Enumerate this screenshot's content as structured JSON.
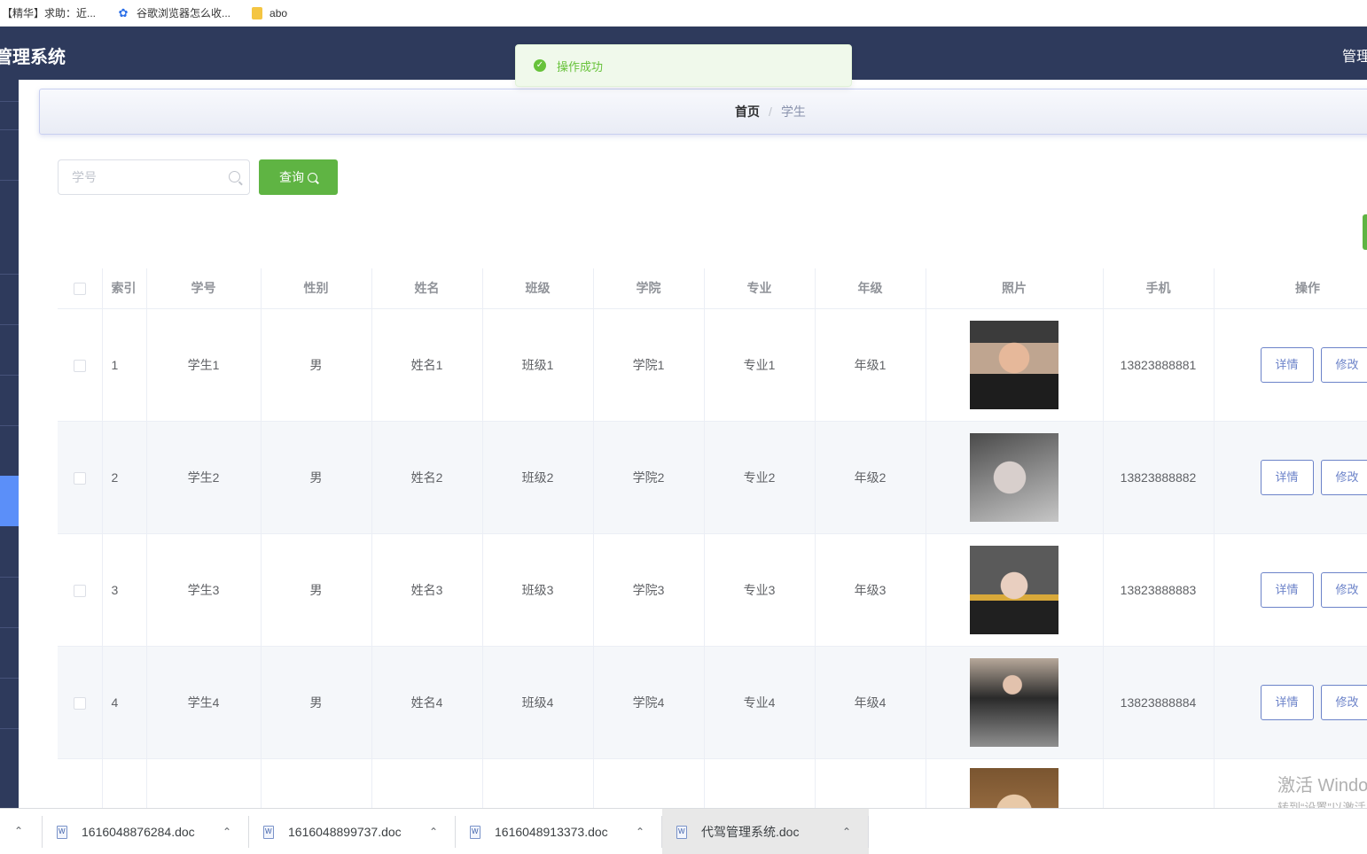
{
  "bookmarks": [
    {
      "label": "【精华】求助：近...",
      "icon": "none"
    },
    {
      "label": "谷歌浏览器怎么收...",
      "icon": "paw-icon"
    },
    {
      "label": "abo",
      "icon": "folder-icon"
    }
  ],
  "header": {
    "title": "管理系统",
    "user": "管理员"
  },
  "breadcrumb": {
    "home": "首页",
    "separator": "/",
    "current": "学生"
  },
  "search": {
    "placeholder": "学号",
    "value": "",
    "button_label": "查询"
  },
  "toast": {
    "message": "操作成功",
    "type": "success"
  },
  "table": {
    "columns": [
      "索引",
      "学号",
      "性别",
      "姓名",
      "班级",
      "学院",
      "专业",
      "年级",
      "照片",
      "手机",
      "操作"
    ],
    "rows": [
      {
        "index": "1",
        "student_no": "学生1",
        "gender": "男",
        "name": "姓名1",
        "class": "班级1",
        "college": "学院1",
        "major": "专业1",
        "grade": "年级1",
        "phone": "13823888881"
      },
      {
        "index": "2",
        "student_no": "学生2",
        "gender": "男",
        "name": "姓名2",
        "class": "班级2",
        "college": "学院2",
        "major": "专业2",
        "grade": "年级2",
        "phone": "13823888882"
      },
      {
        "index": "3",
        "student_no": "学生3",
        "gender": "男",
        "name": "姓名3",
        "class": "班级3",
        "college": "学院3",
        "major": "专业3",
        "grade": "年级3",
        "phone": "13823888883"
      },
      {
        "index": "4",
        "student_no": "学生4",
        "gender": "男",
        "name": "姓名4",
        "class": "班级4",
        "college": "学院4",
        "major": "专业4",
        "grade": "年级4",
        "phone": "13823888884"
      }
    ],
    "actions": {
      "detail": "详情",
      "edit": "修改"
    }
  },
  "watermark": {
    "line1": "激活 Windows",
    "line2": "转到“设置”以激活 Windows。"
  },
  "downloads": [
    {
      "name": "1616048876284.doc"
    },
    {
      "name": "1616048899737.doc"
    },
    {
      "name": "1616048913373.doc"
    },
    {
      "name": "代驾管理系统.doc"
    }
  ],
  "colors": {
    "header_bg": "#2e3a5c",
    "primary_green": "#5fb443",
    "action_blue": "#6c83c9",
    "toast_green": "#67c23a",
    "sidebar_active": "#5b8ff9"
  }
}
